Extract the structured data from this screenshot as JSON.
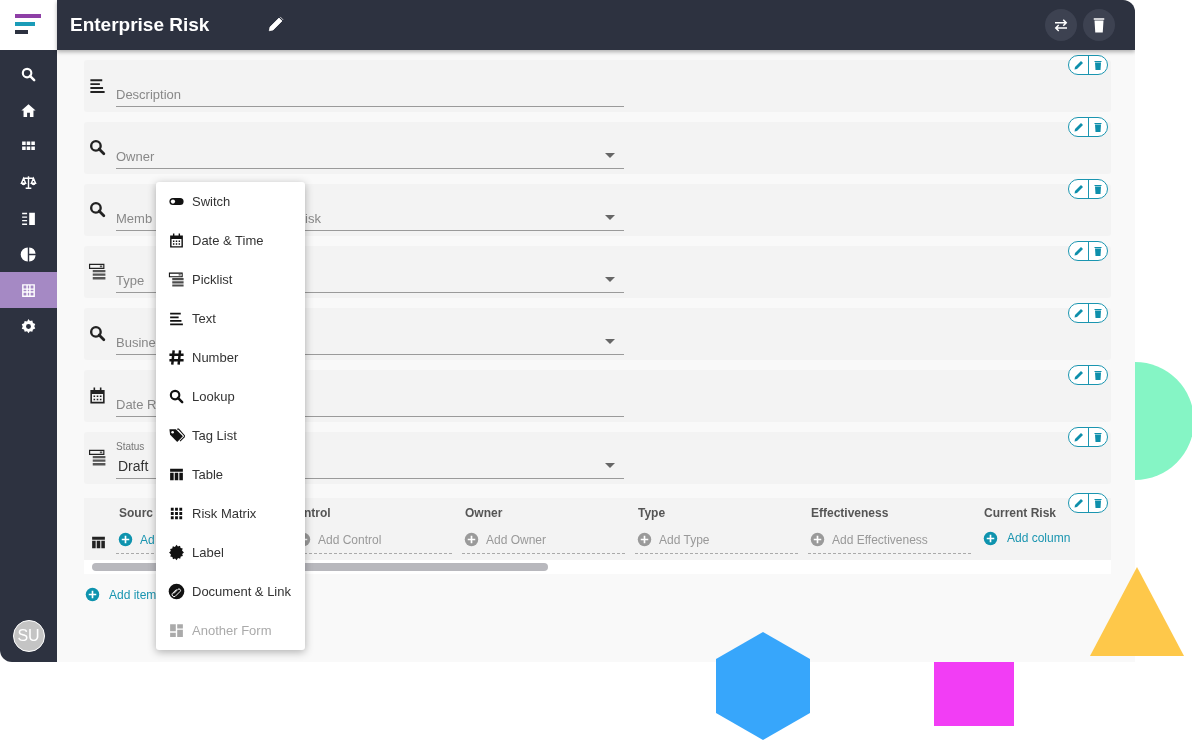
{
  "app_header": {
    "title": "Enterprise Risk"
  },
  "sidebar": {
    "items": [
      {
        "kind": "search",
        "selected": false
      },
      {
        "kind": "home",
        "selected": false
      },
      {
        "kind": "apps",
        "selected": false
      },
      {
        "kind": "scale",
        "selected": false
      },
      {
        "kind": "columns",
        "selected": false
      },
      {
        "kind": "pie",
        "selected": false
      },
      {
        "kind": "table",
        "selected": true
      },
      {
        "kind": "gear",
        "selected": false
      }
    ],
    "avatar": "SU"
  },
  "form": {
    "fields": [
      {
        "kind": "text",
        "placeholder": "Description",
        "dropdown": false
      },
      {
        "kind": "lookup",
        "placeholder": "Owner",
        "dropdown": true
      },
      {
        "kind": "lookup",
        "placeholder": "Memb",
        "placeholder_tail": "isk",
        "dropdown": true
      },
      {
        "kind": "picklist",
        "placeholder": "Type",
        "dropdown": true
      },
      {
        "kind": "lookup",
        "placeholder": "Busine",
        "dropdown": true
      },
      {
        "kind": "date",
        "placeholder": "Date R",
        "dropdown": false
      },
      {
        "kind": "picklist",
        "label": "Status",
        "value": "Draft",
        "dropdown": true
      }
    ],
    "table": {
      "columns": [
        {
          "header": "Sourc",
          "add_label": "Ad",
          "add_enabled": true
        },
        {
          "header": "ntrol",
          "add_label": "Add Control",
          "add_enabled": false
        },
        {
          "header": "Owner",
          "add_label": "Add Owner",
          "add_enabled": false
        },
        {
          "header": "Type",
          "add_label": "Add Type",
          "add_enabled": false
        },
        {
          "header": "Effectiveness",
          "add_label": "Add Effectiveness",
          "add_enabled": false
        },
        {
          "header": "Current Risk",
          "add_label": "Add column",
          "add_enabled": true
        }
      ]
    },
    "add_item": "Add item"
  },
  "field_type_menu": {
    "items": [
      {
        "kind": "switch",
        "label": "Switch",
        "disabled": false
      },
      {
        "kind": "calendar",
        "label": "Date & Time",
        "disabled": false
      },
      {
        "kind": "picklist",
        "label": "Picklist",
        "disabled": false
      },
      {
        "kind": "text",
        "label": "Text",
        "disabled": false
      },
      {
        "kind": "hash",
        "label": "Number",
        "disabled": false
      },
      {
        "kind": "lookup",
        "label": "Lookup",
        "disabled": false
      },
      {
        "kind": "tag",
        "label": "Tag List",
        "disabled": false
      },
      {
        "kind": "table",
        "label": "Table",
        "disabled": false
      },
      {
        "kind": "grid9",
        "label": "Risk Matrix",
        "disabled": false
      },
      {
        "kind": "badge",
        "label": "Label",
        "disabled": false
      },
      {
        "kind": "clip",
        "label": "Document & Link",
        "disabled": false
      },
      {
        "kind": "form",
        "label": "Another Form",
        "disabled": true
      }
    ]
  }
}
